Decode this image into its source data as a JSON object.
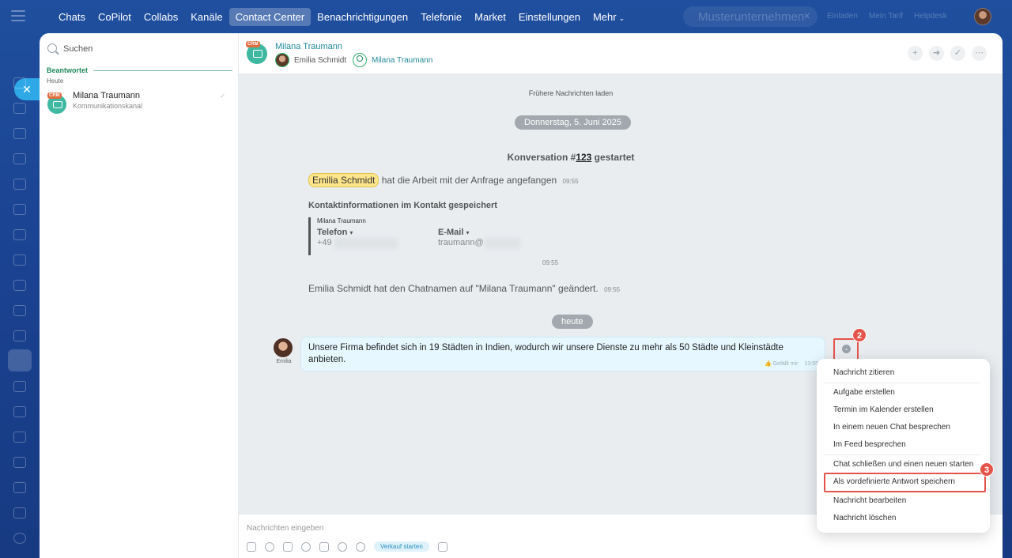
{
  "nav": {
    "items": [
      {
        "label": "Chats",
        "name": "chats"
      },
      {
        "label": "CoPilot",
        "name": "copilot"
      },
      {
        "label": "Collabs",
        "name": "collabs"
      },
      {
        "label": "Kanäle",
        "name": "kanaele"
      },
      {
        "label": "Contact Center",
        "name": "contact-center",
        "active": true
      },
      {
        "label": "Benachrichtigungen",
        "name": "benachrichtigungen"
      },
      {
        "label": "Telefonie",
        "name": "telefonie"
      },
      {
        "label": "Market",
        "name": "market"
      },
      {
        "label": "Einstellungen",
        "name": "einstellungen"
      }
    ],
    "more_label": "Mehr",
    "company": "Musterunternehmen",
    "links": [
      "Einladen",
      "Mein Tarif",
      "Helpdesk"
    ]
  },
  "list": {
    "search_placeholder": "Suchen",
    "section": "Beantwortet",
    "day": "Heute",
    "items": [
      {
        "name": "Milana Traumann",
        "sub": "Kommunikationskanal",
        "badge": "CRM"
      }
    ]
  },
  "chat": {
    "badge": "CRM",
    "title": "Milana Traumann",
    "members": [
      "Emilia Schmidt",
      "Milana Traumann"
    ],
    "load_more": "Frühere Nachrichten laden",
    "date1": "Donnerstag, 5. Juni 2025",
    "conv_prefix": "Konversation #",
    "conv_num": "123",
    "conv_suffix": " gestartet",
    "sys1_tag": "Emilia Schmidt",
    "sys1_text": "hat die Arbeit mit der Anfrage angefangen",
    "sys1_time": "09:55",
    "contact_title": "Kontaktinformationen im Kontakt gespeichert",
    "contact_name": "Milana Traumann",
    "phone_label": "Telefon",
    "phone_value": "+49",
    "email_label": "E-Mail",
    "email_value": "traumann@",
    "contact_time": "09:55",
    "sys2_text": "Emilia Schmidt hat den Chatnamen auf \"Milana Traumann\" geändert.",
    "sys2_time": "09:55",
    "date2": "heute",
    "msg_author": "Emilia",
    "msg_text": "Unsere Firma befindet sich in 19 Städten in Indien, wodurch wir unsere Dienste zu mehr als 50 Städte und Kleinstädte anbieten.",
    "msg_like": "Gefällt mir",
    "msg_time": "13:55",
    "composer_placeholder": "Nachrichten eingeben",
    "sale_button": "Verkauf starten"
  },
  "menu": {
    "quote": "Nachricht zitieren",
    "task": "Aufgabe erstellen",
    "calendar": "Termin im Kalender erstellen",
    "new_chat": "In einem neuen Chat besprechen",
    "feed": "Im Feed besprechen",
    "close_chat": "Chat schließen und einen neuen starten",
    "save_answer": "Als vordefinierte Antwort speichern",
    "edit": "Nachricht bearbeiten",
    "delete": "Nachricht löschen"
  },
  "steps": [
    "2",
    "3"
  ],
  "colors": {
    "accent_red": "#e5544b",
    "green": "#1f8a5a",
    "crm_orange": "#e06c3f",
    "brand_blue": "#1f4f9e"
  }
}
